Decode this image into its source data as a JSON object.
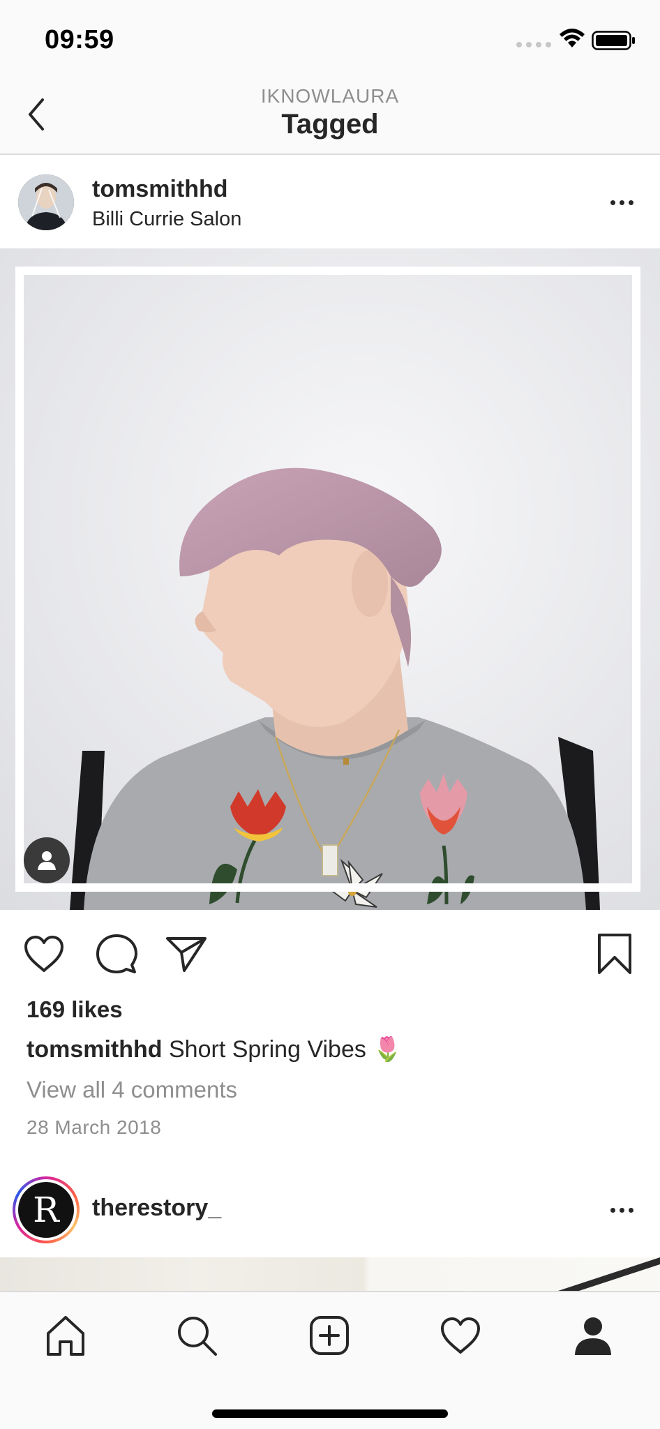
{
  "status_bar": {
    "time": "09:59"
  },
  "nav": {
    "subtitle": "IKNOWLAURA",
    "title": "Tagged"
  },
  "post": {
    "username": "tomsmithhd",
    "location": "Billi Currie Salon",
    "likes": "169 likes",
    "caption_user": "tomsmithhd",
    "caption_text": "Short Spring Vibes",
    "caption_emoji": "🌷",
    "view_comments": "View all 4 comments",
    "date": "28 March 2018"
  },
  "next_post": {
    "username": "therestory_",
    "avatar_letter": "R"
  },
  "icons": {
    "back": "chevron-left-icon",
    "more": "more-horizontal-icon",
    "like": "heart-icon",
    "comment": "comment-icon",
    "share": "paper-plane-icon",
    "save": "bookmark-icon",
    "tag": "person-icon",
    "tabs": [
      "home-icon",
      "search-icon",
      "add-post-icon",
      "activity-heart-icon",
      "profile-icon"
    ]
  },
  "colors": {
    "text": "#262626",
    "secondary": "#8e8e8e",
    "divider": "#dbdbdb",
    "bar_bg": "#fafafa"
  }
}
